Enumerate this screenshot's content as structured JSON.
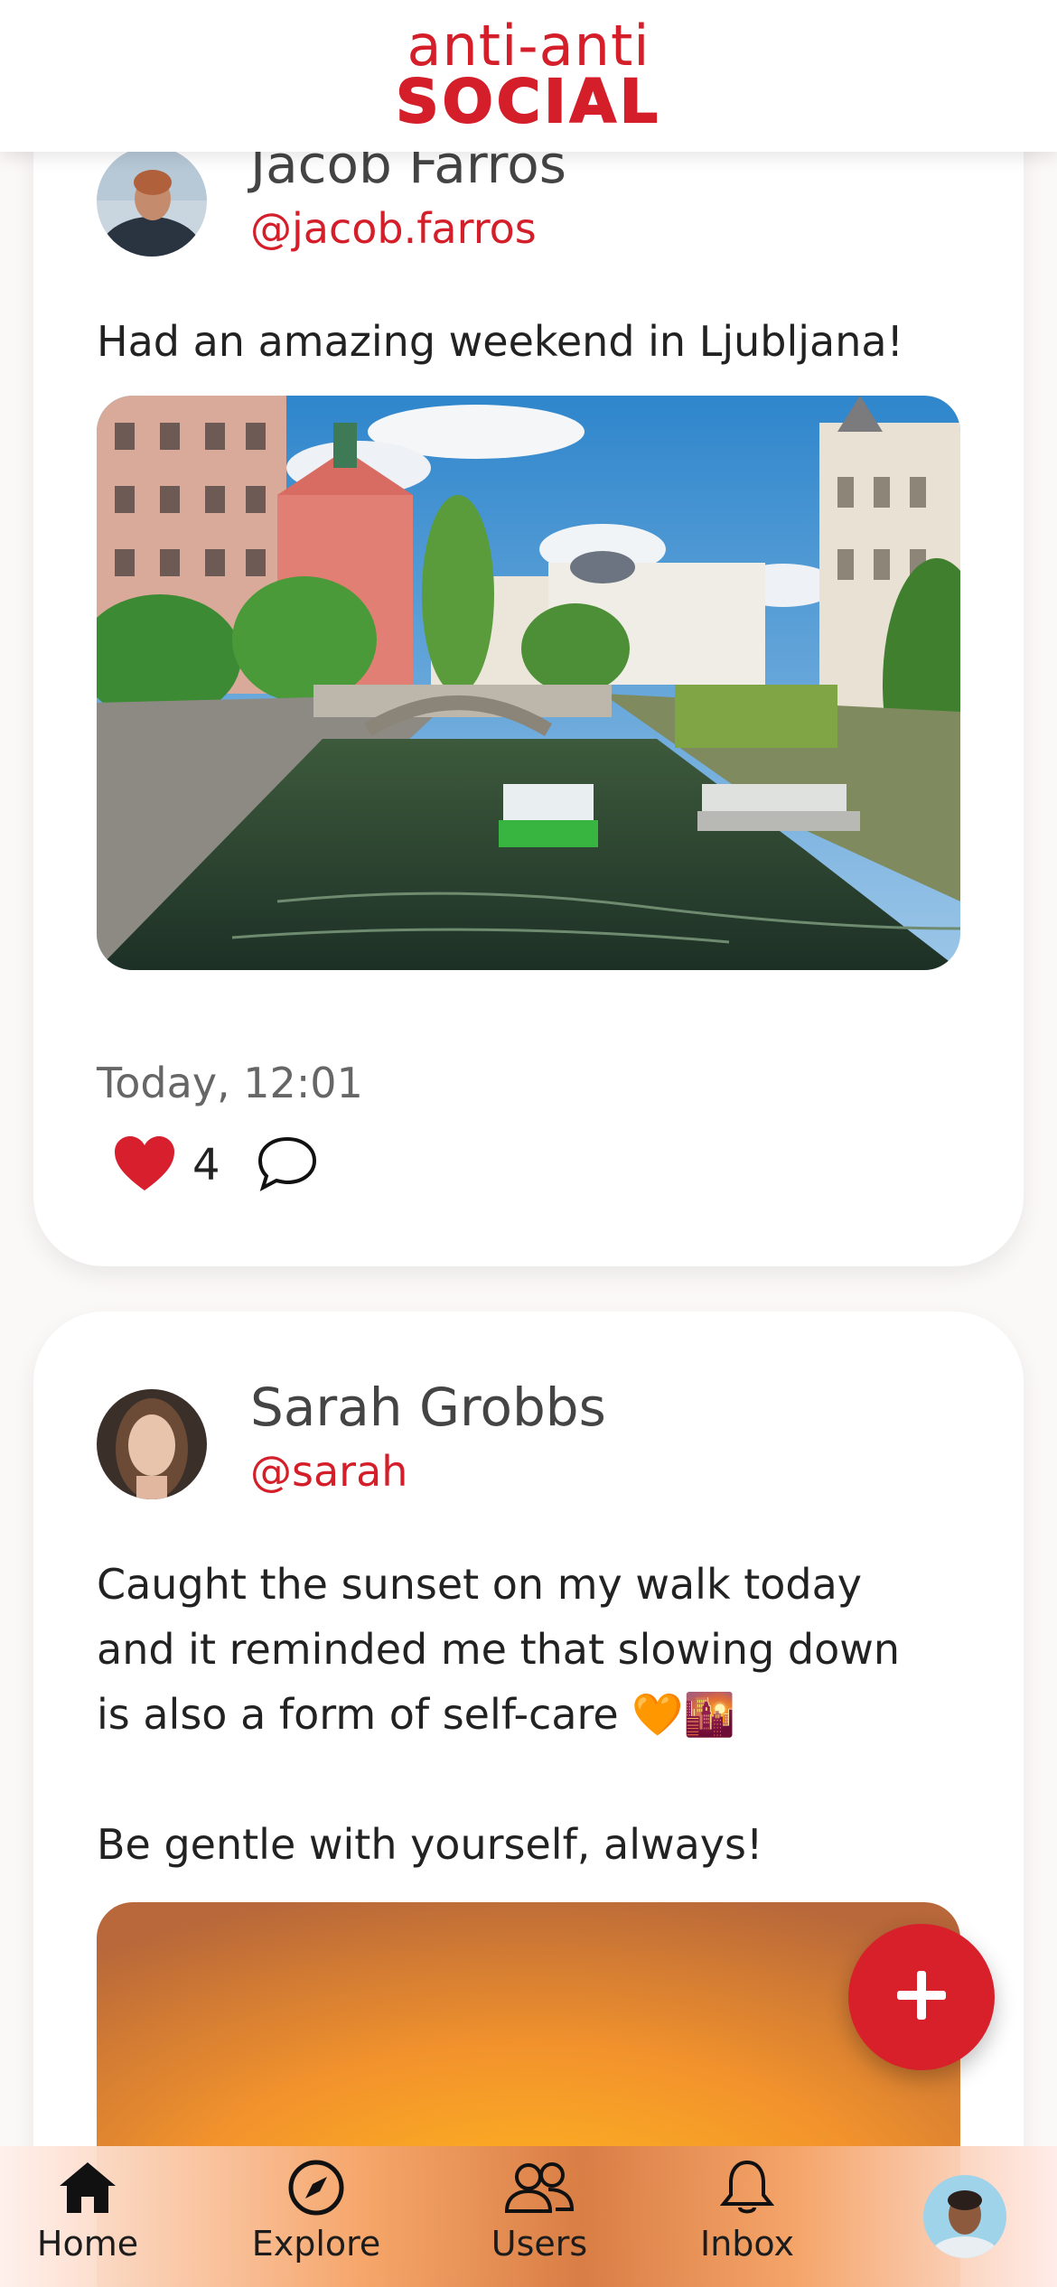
{
  "app": {
    "logo_top": "anti-anti",
    "logo_bottom": "SOCIAL",
    "brand_color": "#d41f2a"
  },
  "posts": [
    {
      "author_name": "Jacob Farros",
      "author_handle": "@jacob.farros",
      "text": "Had an amazing weekend in Ljubljana!",
      "image": "canal-city-photo",
      "time": "Today, 12:01",
      "likes": "4",
      "liked": true
    },
    {
      "author_name": "Sarah Grobbs",
      "author_handle": "@sarah",
      "text_line_1": "Caught the sunset on my walk today",
      "text_line_2": "and it reminded me that slowing down",
      "text_line_3": "is also a form of self-care 🧡🌇",
      "text_line_4": "Be gentle with yourself, always!",
      "image": "sunset-photo"
    }
  ],
  "fab": {
    "icon": "plus-icon"
  },
  "nav": {
    "items": [
      {
        "label": "Home",
        "icon": "home-icon",
        "active": true
      },
      {
        "label": "Explore",
        "icon": "compass-icon"
      },
      {
        "label": "Users",
        "icon": "users-icon"
      },
      {
        "label": "Inbox",
        "icon": "bell-icon"
      }
    ],
    "profile_icon": "profile-avatar"
  }
}
